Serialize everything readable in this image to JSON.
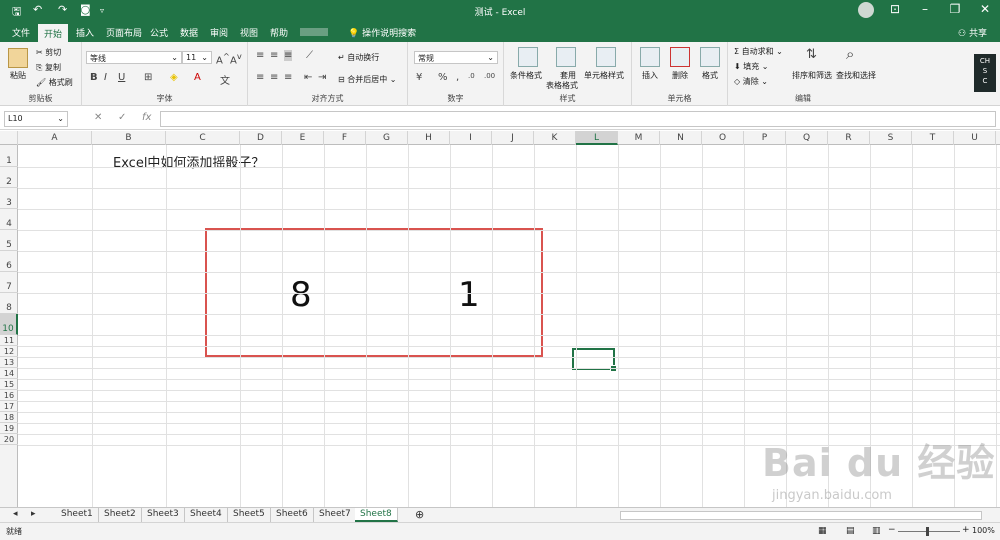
{
  "window": {
    "title": "测试 - Excel",
    "share_label": "共享"
  },
  "quick_access": {
    "save_icon": "save-icon",
    "undo_icon": "undo-icon",
    "redo_icon": "redo-icon",
    "camera_icon": "camera-icon"
  },
  "tabs": [
    {
      "label": "文件"
    },
    {
      "label": "开始"
    },
    {
      "label": "插入"
    },
    {
      "label": "页面布局"
    },
    {
      "label": "公式"
    },
    {
      "label": "数据"
    },
    {
      "label": "审阅"
    },
    {
      "label": "视图"
    },
    {
      "label": "帮助"
    }
  ],
  "search": {
    "label": "操作说明搜索"
  },
  "ribbon": {
    "clipboard": {
      "paste": "粘贴",
      "cut": "剪切",
      "copy": "复制",
      "format_painter": "格式刷",
      "group": "剪贴板"
    },
    "font": {
      "name": "等线",
      "size": "11",
      "group": "字体"
    },
    "alignment": {
      "wrap": "自动换行",
      "merge": "合并后居中",
      "group": "对齐方式"
    },
    "number": {
      "format": "常规",
      "group": "数字"
    },
    "styles": {
      "conditional": "条件格式",
      "table_format_1": "套用",
      "table_format_2": "表格格式",
      "cell_styles": "单元格样式",
      "group": "样式"
    },
    "cells": {
      "insert": "插入",
      "delete": "删除",
      "format": "格式",
      "group": "单元格"
    },
    "editing": {
      "autosum": "自动求和",
      "fill": "填充",
      "clear": "清除",
      "sort": "排序和筛选",
      "find": "查找和选择",
      "group": "编辑"
    }
  },
  "ime": {
    "line1": "CH",
    "line2": "S",
    "line3": "C"
  },
  "formula_bar": {
    "name_box": "L10",
    "fx": "fx"
  },
  "columns": [
    "A",
    "B",
    "C",
    "D",
    "E",
    "F",
    "G",
    "H",
    "I",
    "J",
    "K",
    "L",
    "M",
    "N",
    "O",
    "P",
    "Q",
    "R",
    "S",
    "T",
    "U"
  ],
  "selected_column": "L",
  "rows": [
    "1",
    "2",
    "3",
    "4",
    "5",
    "6",
    "7",
    "8",
    "10",
    "11",
    "12",
    "13",
    "14",
    "15",
    "16",
    "17",
    "18",
    "19",
    "20"
  ],
  "selected_row": "10",
  "cells": {
    "title": "Excel中如何添加摇骰子？",
    "die1": "8",
    "die2": "1"
  },
  "sheets": [
    "Sheet1",
    "Sheet2",
    "Sheet3",
    "Sheet4",
    "Sheet5",
    "Sheet6",
    "Sheet7",
    "Sheet8"
  ],
  "active_sheet": "Sheet8",
  "status": {
    "ready": "就绪",
    "zoom": "100%"
  },
  "watermark": {
    "main": "Bai du 经验",
    "url": "jingyan.baidu.com"
  },
  "colors": {
    "accent": "#217346",
    "dice_border": "#d9534f"
  }
}
